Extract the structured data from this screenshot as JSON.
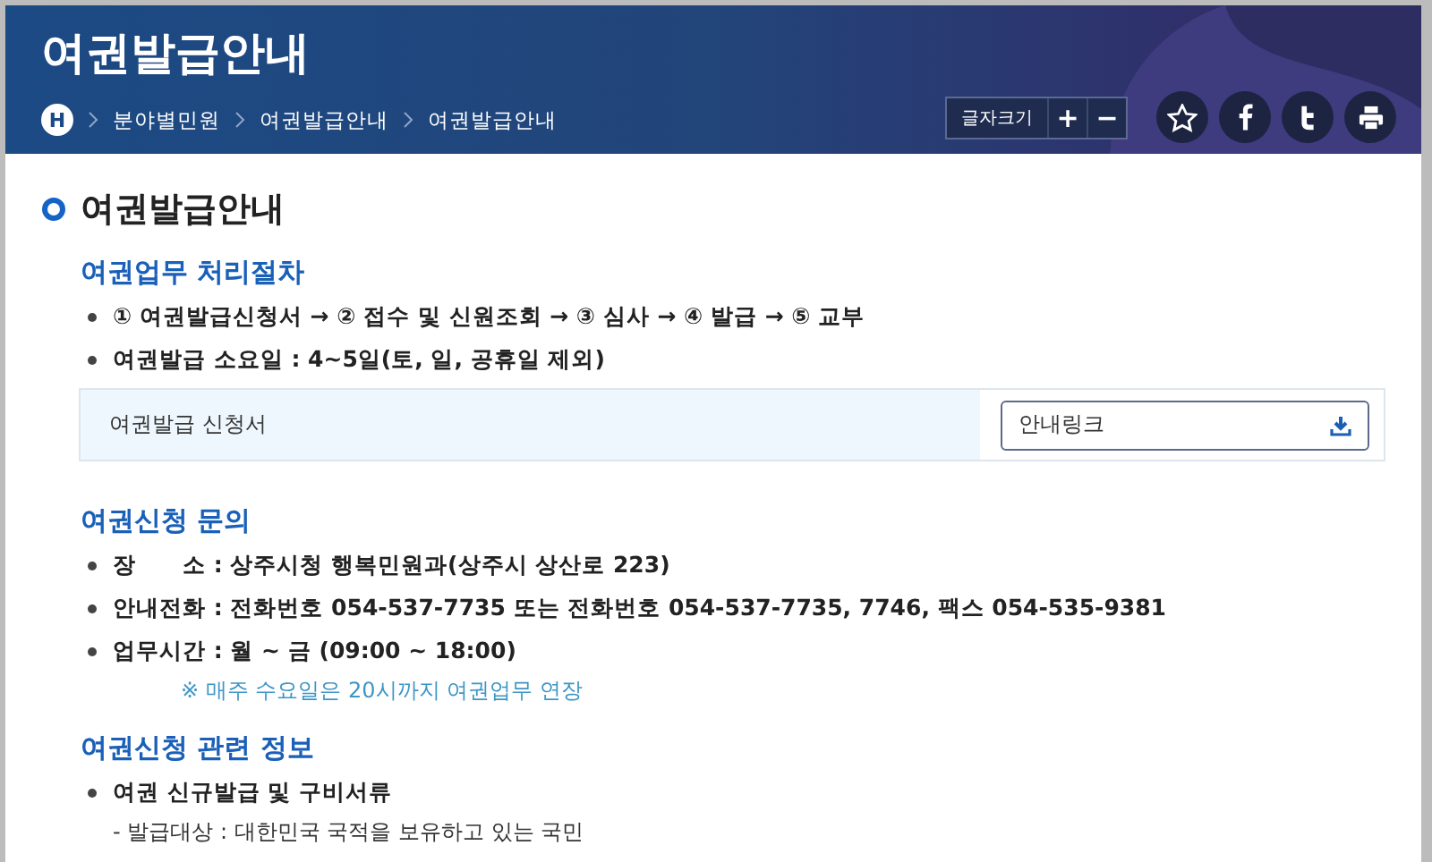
{
  "header": {
    "title": "여권발급안내",
    "breadcrumb": {
      "home_label": "H",
      "items": [
        "분야별민원",
        "여권발급안내",
        "여권발급안내"
      ]
    },
    "font_size": {
      "label": "글자크기",
      "increase": "+",
      "decrease": "−"
    },
    "share_buttons": [
      {
        "kind": "favorite"
      },
      {
        "kind": "facebook"
      },
      {
        "kind": "twitter"
      },
      {
        "kind": "print"
      }
    ]
  },
  "content": {
    "title": "여권발급안내",
    "sections": [
      {
        "heading": "여권업무 처리절차",
        "items": [
          {
            "kind": "bullet",
            "text": "① 여권발급신청서 → ② 접수 및 신원조회 → ③ 심사 → ④ 발급 → ⑤ 교부"
          },
          {
            "kind": "bullet",
            "text": "여권발급 소요일 : 4~5일(토, 일, 공휴일 제외)"
          },
          {
            "kind": "download",
            "label": "여권발급 신청서",
            "link": "안내링크"
          }
        ]
      },
      {
        "heading": "여권신청 문의",
        "items": [
          {
            "kind": "bullet",
            "text": "장　　소 : 상주시청 행복민원과(상주시 상산로 223)"
          },
          {
            "kind": "bullet",
            "text": "안내전화 : 전화번호 054-537-7735 또는 전화번호 054-537-7735, 7746, 팩스 054-535-9381"
          },
          {
            "kind": "bullet",
            "text": "업무시간 : 월 ~ 금 (09:00 ~ 18:00)"
          },
          {
            "kind": "note",
            "text": "※ 매주 수요일은 20시까지 여권업무 연장"
          }
        ]
      },
      {
        "heading": "여권신청 관련 정보",
        "items": [
          {
            "kind": "bullet",
            "text": "여권 신규발급 및 구비서류"
          },
          {
            "kind": "subline",
            "text": "- 발급대상 : 대한민국 국적을 보유하고 있는 국민"
          }
        ]
      }
    ]
  }
}
